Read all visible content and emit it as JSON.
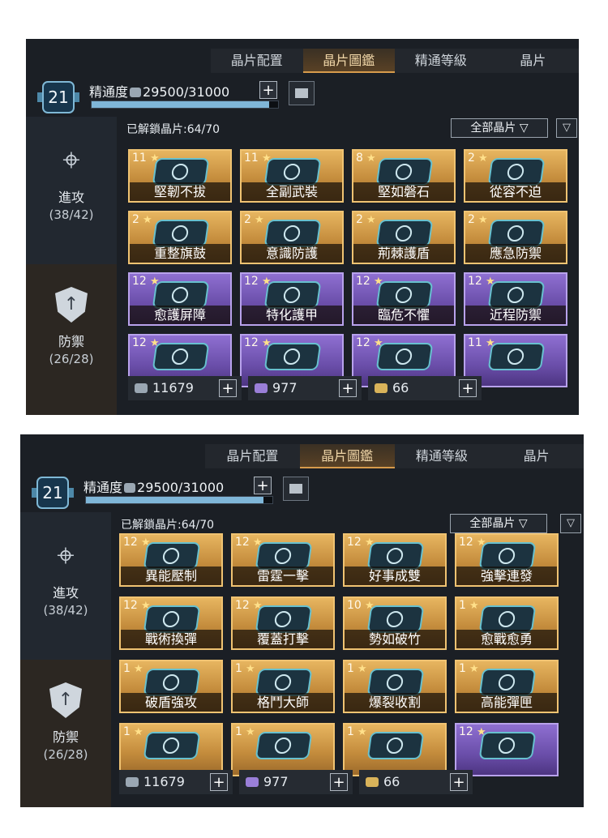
{
  "colors": {
    "gold_card": "#d6a24d",
    "purple_card": "#7a5bc0",
    "accent_tab": "#d79b4c",
    "progress": "#7fb6d8"
  },
  "panels": [
    {
      "tabs": [
        "晶片配置",
        "晶片圖鑑",
        "精通等級",
        "晶片"
      ],
      "active_tab": 1,
      "level": "21",
      "mastery": {
        "label": "精通度",
        "value": "29500/31000",
        "fraction": 0.9516
      },
      "sidebar": [
        {
          "name": "進攻",
          "count": "(38/42)",
          "icon": "crosshair-icon"
        },
        {
          "name": "防禦",
          "count": "(26/28)",
          "icon": "shield-icon"
        }
      ],
      "unlocked": "已解鎖晶片:64/70",
      "filter": "全部晶片",
      "cards": [
        {
          "level": "11",
          "name": "堅韌不拔",
          "color": "gold"
        },
        {
          "level": "11",
          "name": "全副武裝",
          "color": "gold"
        },
        {
          "level": "8",
          "name": "堅如磐石",
          "color": "gold"
        },
        {
          "level": "2",
          "name": "從容不迫",
          "color": "gold"
        },
        {
          "level": "2",
          "name": "重整旗鼓",
          "color": "gold"
        },
        {
          "level": "2",
          "name": "意識防護",
          "color": "gold"
        },
        {
          "level": "2",
          "name": "荊棘護盾",
          "color": "gold"
        },
        {
          "level": "2",
          "name": "應急防禦",
          "color": "gold"
        },
        {
          "level": "12",
          "name": "愈護屏障",
          "color": "purple"
        },
        {
          "level": "12",
          "name": "特化護甲",
          "color": "purple"
        },
        {
          "level": "12",
          "name": "臨危不懼",
          "color": "purple"
        },
        {
          "level": "12",
          "name": "近程防禦",
          "color": "purple"
        },
        {
          "level": "12",
          "name": "",
          "color": "purple"
        },
        {
          "level": "12",
          "name": "",
          "color": "purple"
        },
        {
          "level": "12",
          "name": "",
          "color": "purple"
        },
        {
          "level": "11",
          "name": "",
          "color": "purple"
        }
      ],
      "resources": [
        {
          "value": "11679",
          "icon": "grey-chip-icon"
        },
        {
          "value": "977",
          "icon": "purple-chip-icon"
        },
        {
          "value": "66",
          "icon": "gold-chip-icon"
        }
      ]
    },
    {
      "tabs": [
        "晶片配置",
        "晶片圖鑑",
        "精通等級",
        "晶片"
      ],
      "active_tab": 1,
      "level": "21",
      "mastery": {
        "label": "精通度",
        "value": "29500/31000",
        "fraction": 0.9516
      },
      "sidebar": [
        {
          "name": "進攻",
          "count": "(38/42)",
          "icon": "crosshair-icon"
        },
        {
          "name": "防禦",
          "count": "(26/28)",
          "icon": "shield-icon"
        }
      ],
      "unlocked": "已解鎖晶片:64/70",
      "filter": "全部晶片",
      "cards": [
        {
          "level": "12",
          "name": "異能壓制",
          "color": "gold"
        },
        {
          "level": "12",
          "name": "雷霆一擊",
          "color": "gold"
        },
        {
          "level": "12",
          "name": "好事成雙",
          "color": "gold"
        },
        {
          "level": "12",
          "name": "強擊連發",
          "color": "gold"
        },
        {
          "level": "12",
          "name": "戰術換彈",
          "color": "gold"
        },
        {
          "level": "12",
          "name": "覆蓋打擊",
          "color": "gold"
        },
        {
          "level": "10",
          "name": "勢如破竹",
          "color": "gold"
        },
        {
          "level": "1",
          "name": "愈戰愈勇",
          "color": "gold"
        },
        {
          "level": "1",
          "name": "破盾強攻",
          "color": "gold"
        },
        {
          "level": "1",
          "name": "格鬥大師",
          "color": "gold"
        },
        {
          "level": "1",
          "name": "爆裂收割",
          "color": "gold"
        },
        {
          "level": "1",
          "name": "高能彈匣",
          "color": "gold"
        },
        {
          "level": "1",
          "name": "",
          "color": "gold"
        },
        {
          "level": "1",
          "name": "",
          "color": "gold"
        },
        {
          "level": "1",
          "name": "",
          "color": "gold"
        },
        {
          "level": "12",
          "name": "",
          "color": "purple"
        }
      ],
      "resources": [
        {
          "value": "11679",
          "icon": "grey-chip-icon"
        },
        {
          "value": "977",
          "icon": "purple-chip-icon"
        },
        {
          "value": "66",
          "icon": "gold-chip-icon"
        }
      ]
    }
  ]
}
